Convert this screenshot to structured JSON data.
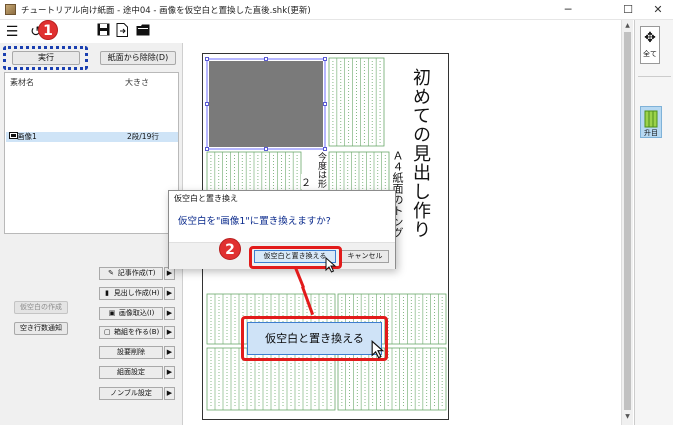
{
  "window": {
    "title": "チュートリアル向け紙面 - 途中04 - 画像を仮空白と置換した直後.shk(更新)",
    "minimize_glyph": "─",
    "maximize_glyph": "☐",
    "close_glyph": "✕"
  },
  "toolbar": {
    "menu_icon_glyph": "☰",
    "undo_icon_glyph": "↺",
    "save_icon_glyph": "💾",
    "export_icon_glyph": "⎘",
    "folder_icon_glyph": "▬"
  },
  "left_panel": {
    "execute_label": "実行",
    "remove_from_page_label": "紙面から除除(D)",
    "list": {
      "columns": [
        "素材名",
        "大きさ"
      ],
      "rows": [
        {
          "name": "画像1",
          "size": "2段/19行"
        }
      ]
    },
    "side_buttons": [
      {
        "label": "仮空白の作成",
        "disabled": true
      },
      {
        "label": "空き行数通知",
        "disabled": false
      }
    ],
    "menu_buttons": [
      {
        "icon": "✎",
        "label": "記事作成(T)"
      },
      {
        "icon": "▮",
        "label": "見出し作成(H)"
      },
      {
        "icon": "▣",
        "label": "画像取込(I)"
      },
      {
        "icon": "▢",
        "label": "箱組を作る(B)"
      },
      {
        "icon": "",
        "label": "設要削除"
      },
      {
        "icon": "",
        "label": "組面設定"
      },
      {
        "icon": "",
        "label": "ノンブル設定"
      }
    ],
    "arrow_glyph": "▶"
  },
  "page": {
    "headline": "初めての見出し作り",
    "subheadline": "Ａ４紙面のトング",
    "small_text_1": "今度は形",
    "small_text_2": "２"
  },
  "dialog": {
    "title": "仮空白と置き換え",
    "message": "仮空白を\"画像1\"に置き換えますか?",
    "ok_label": "仮空白と置き換える",
    "cancel_label": "キャンセル"
  },
  "callouts": {
    "badge_1": "1",
    "badge_2": "2",
    "zoomed_button_label": "仮空白と置き換える"
  },
  "right_panel": {
    "all_label": "全て",
    "half_label": "升目"
  },
  "colors": {
    "highlight_red": "#e21b1b",
    "highlight_blue": "#1a3fb0",
    "grid_green": "#6aa86a",
    "image_gray": "#7a7a7a"
  }
}
